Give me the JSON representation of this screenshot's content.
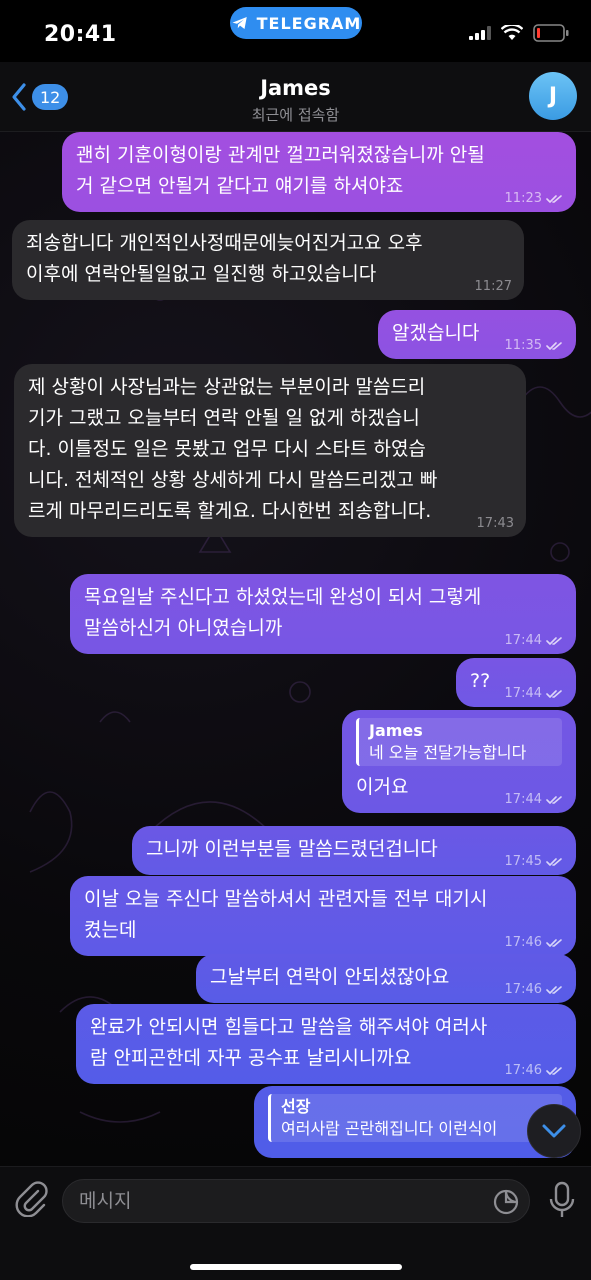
{
  "status_bar": {
    "time": "20:41",
    "app_pill": "TELEGRAM"
  },
  "header": {
    "back_count": "12",
    "title": "James",
    "subtitle": "최근에 접속함",
    "avatar_letter": "J"
  },
  "messages": [
    {
      "type": "out",
      "text": "괜히 기훈이형이랑 관계만 껄끄러워졌잖습니까 안될거 같으면 안될거 같다고 얘기를 하셔야죠",
      "time": "11:23"
    },
    {
      "type": "in",
      "text": "죄송합니다 개인적인사정때문에늦어진거고요 오후 이후에 연락안될일없고 일진행 하고있습니다",
      "time": "11:27"
    },
    {
      "type": "out",
      "text": "알겠습니다",
      "time": "11:35"
    },
    {
      "type": "in",
      "text": "제 상황이 사장님과는 상관없는 부분이라 말씀드리기가 그랬고 오늘부터 연락 안될 일 없게 하겠습니다. 이틀정도 일은 못봤고 업무 다시 스타트 하였습니다. 전체적인 상황 상세하게 다시 말씀드리겠고 빠르게 마무리드리도록 할게요. 다시한번 죄송합니다.",
      "time": "17:43"
    },
    {
      "type": "out",
      "text": "목요일날 주신다고 하셨었는데 완성이 되서 그렇게 말씀하신거 아니였습니까",
      "time": "17:44"
    },
    {
      "type": "out",
      "text": "??",
      "time": "17:44"
    },
    {
      "type": "out",
      "quote_name": "James",
      "quote_text": "네 오늘 전달가능합니다",
      "text": "이거요",
      "time": "17:44"
    },
    {
      "type": "out",
      "text": "그니까 이런부분들 말씀드렸던겁니다",
      "time": "17:45"
    },
    {
      "type": "out",
      "text": "이날 오늘 주신다 말씀하셔서 관련자들 전부 대기시켰는데",
      "time": "17:46"
    },
    {
      "type": "out",
      "text": "그날부터 연락이 안되셨잖아요",
      "time": "17:46"
    },
    {
      "type": "out",
      "text": "완료가 안되시면 힘들다고 말씀을 해주셔야 여러사람 안피곤한데 자꾸 공수표 날리시니까요",
      "time": "17:46"
    },
    {
      "type": "out",
      "quote_name": "선장",
      "quote_text": "여러사람 곤란해집니다 이런식이",
      "text": "",
      "time": ""
    }
  ],
  "input": {
    "placeholder": "메시지"
  },
  "icons": {
    "attach": "paperclip-icon",
    "sticker": "sticker-icon",
    "mic": "microphone-icon",
    "scroll": "chevron-down-icon",
    "back": "chevron-left-icon"
  },
  "colors": {
    "accent": "#3d8fe8",
    "incoming_bubble": "#2b2a2d",
    "outgoing_gradient_top": "#a34fe0",
    "outgoing_gradient_bottom": "#4f5de8"
  }
}
